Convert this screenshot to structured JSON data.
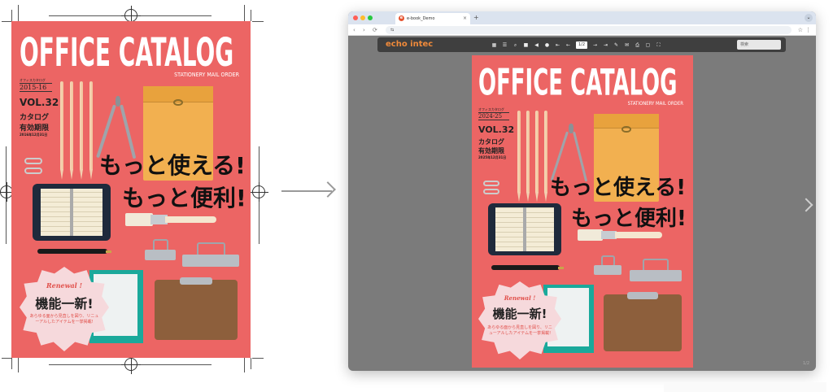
{
  "catalog": {
    "title": "OFFICE CATALOG",
    "subtitle": "STATIONERY MAIL ORDER",
    "slogan_line1": "もっと使える!",
    "slogan_line2": "もっと便利!",
    "badge": {
      "renewal": "Renewal !",
      "headline": "機能一新!",
      "text": "あらゆる面から見直しを図り、リニューアルしたアイテムを一挙掲載!"
    }
  },
  "print_proof": {
    "label_small": "オフィスカタログ",
    "years": "2015-16",
    "vol": "VOL.32",
    "validity_line1": "カタログ",
    "validity_line2": "有効期限",
    "expiry": "2016年12月31日"
  },
  "ebook_cover": {
    "label_small": "オフィスカタログ",
    "years": "2024-25",
    "vol": "VOL.32",
    "validity_line1": "カタログ",
    "validity_line2": "有効期限",
    "expiry": "2025年12月31日"
  },
  "browser": {
    "tab_title": "e-book_Demo",
    "favicon": "e",
    "tab_close": "×",
    "new_tab": "+",
    "tab_menu": "⌄",
    "back": "‹",
    "forward": "›",
    "reload": "⟳",
    "site_info": "⇆",
    "bookmark": "☆",
    "menu": "⋮",
    "accent_colors": {
      "close": "#ff5f57",
      "minimize": "#febc2e",
      "maximize": "#28c840"
    }
  },
  "viewer": {
    "brand": "echo intec",
    "brand_color": "#f08a3a",
    "search_placeholder": "検索",
    "page_value": "1/2",
    "page_indicator": "1/2",
    "tools": [
      {
        "name": "thumbnail-icon",
        "glyph": "▦"
      },
      {
        "name": "list-icon",
        "glyph": "☰"
      },
      {
        "name": "zoom-icon",
        "glyph": "⌕"
      },
      {
        "name": "bookmark-icon",
        "glyph": "■"
      },
      {
        "name": "speaker-icon",
        "glyph": "◀"
      },
      {
        "name": "comment-icon",
        "glyph": "●"
      },
      {
        "name": "first-page-icon",
        "glyph": "⇤"
      },
      {
        "name": "prev-page-icon",
        "glyph": "←"
      }
    ],
    "tools_right": [
      {
        "name": "next-page-icon",
        "glyph": "→"
      },
      {
        "name": "last-page-icon",
        "glyph": "⇥"
      },
      {
        "name": "edit-icon",
        "glyph": "✎"
      },
      {
        "name": "mail-icon",
        "glyph": "✉"
      },
      {
        "name": "print-icon",
        "glyph": "⎙"
      },
      {
        "name": "window-icon",
        "glyph": "▢"
      },
      {
        "name": "fullscreen-icon",
        "glyph": "⛶"
      }
    ]
  }
}
